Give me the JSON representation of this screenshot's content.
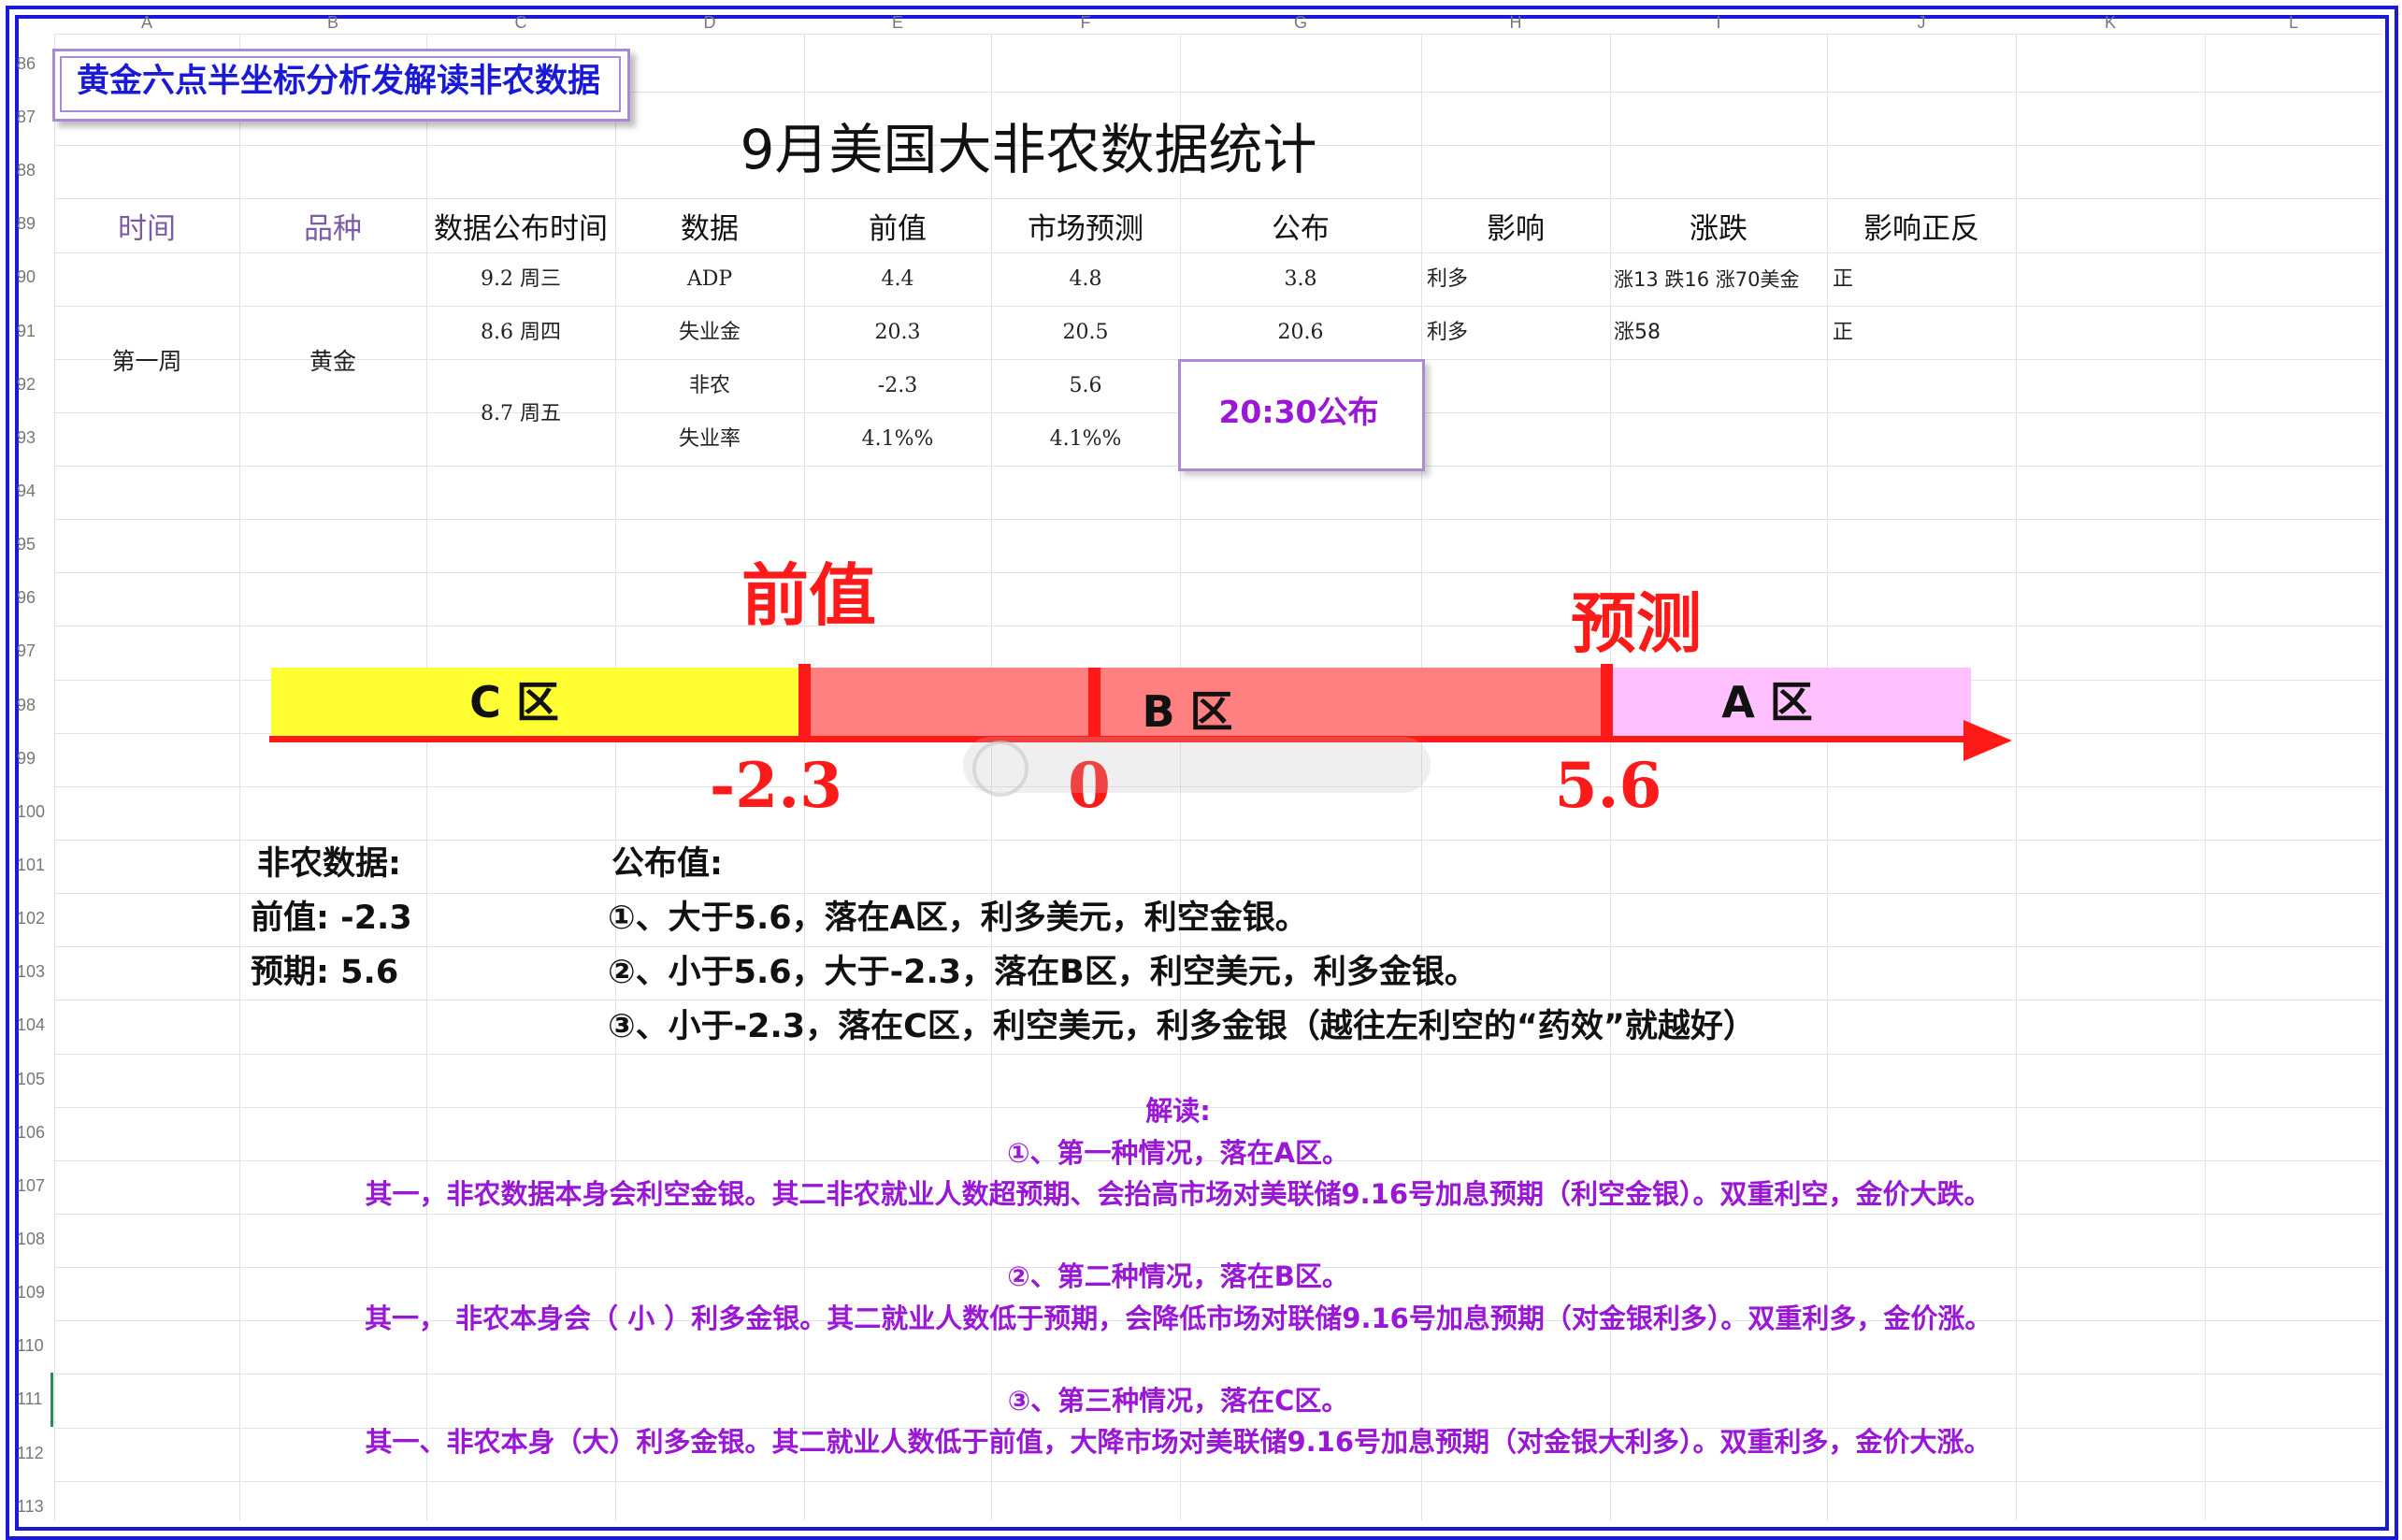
{
  "sheet": {
    "columns": [
      "A",
      "B",
      "C",
      "D",
      "E",
      "F",
      "G",
      "H",
      "I",
      "J",
      "K",
      "L"
    ],
    "rows": [
      "86",
      "87",
      "88",
      "89",
      "90",
      "91",
      "92",
      "93",
      "94",
      "95",
      "96",
      "97",
      "98",
      "99",
      "100",
      "101",
      "102",
      "103",
      "104",
      "105",
      "106",
      "107",
      "108",
      "109",
      "110",
      "111",
      "112",
      "113"
    ]
  },
  "header_badge": "黄金六点半坐标分析发解读非农数据",
  "main_title": "9月美国大非农数据统计",
  "table": {
    "headers": {
      "time": "时间",
      "variety": "品种",
      "release_time": "数据公布时间",
      "data": "数据",
      "previous": "前值",
      "forecast": "市场预测",
      "published": "公布",
      "impact": "影响",
      "change": "涨跌",
      "direction": "影响正反"
    },
    "week": "第一周",
    "asset": "黄金",
    "rows": [
      {
        "date": "9.2 周三",
        "name": "ADP",
        "prev": "4.4",
        "fcst": "4.8",
        "pub": "3.8",
        "impact": "利多",
        "change": "涨13 跌16 涨70美金",
        "dir": "正"
      },
      {
        "date": "8.6 周四",
        "name": "失业金",
        "prev": "20.3",
        "fcst": "20.5",
        "pub": "20.6",
        "impact": "利多",
        "change": "涨58",
        "dir": "正"
      },
      {
        "date": "8.7 周五",
        "name": "非农",
        "prev": "-2.3",
        "fcst": "5.6"
      },
      {
        "name": "失业率",
        "prev": "4.1%%",
        "fcst": "4.1%%"
      }
    ],
    "publish_time": "20:30公布"
  },
  "axis_diagram": {
    "label_prev": "前值",
    "label_forecast": "预测",
    "zone_c": "C 区",
    "zone_b": "B 区",
    "zone_a": "A 区",
    "value_prev": "-2.3",
    "value_zero": "0",
    "value_forecast": "5.6",
    "colors": {
      "zone_c": "#ffff33",
      "zone_b": "#ff8080",
      "zone_a": "#ffc0ff",
      "axis": "#ff1a1a"
    }
  },
  "summary": {
    "nfp_label": "非农数据:",
    "prev_line": "前值:  -2.3",
    "forecast_line": "预期:   5.6",
    "published_label": "公布值:",
    "case1": "①、大于5.6，落在A区，利多美元，利空金银。",
    "case2": "②、小于5.6，大于-2.3，落在B区，利空美元，利多金银。",
    "case3": "③、小于-2.3，落在C区，利空美元，利多金银（越往左利空的“药效”就越好）"
  },
  "interpretation": {
    "title": "解读:",
    "s1_title": "①、第一种情况，落在A区。",
    "s1_text": "其一，非农数据本身会利空金银。其二非农就业人数超预期、会抬高市场对美联储9.16号加息预期（利空金银）。双重利空，金价大跌。",
    "s2_title": "②、第二种情况，落在B区。",
    "s2_text": "其一， 非农本身会（ 小 ）利多金银。其二就业人数低于预期，会降低市场对联储9.16号加息预期（对金银利多）。双重利多，金价涨。",
    "s3_title": "③、第三种情况，落在C区。",
    "s3_text": "其一、非农本身（大）利多金银。其二就业人数低于前值，大降市场对美联储9.16号加息预期（对金银大利多）。双重利多，金价大涨。"
  }
}
